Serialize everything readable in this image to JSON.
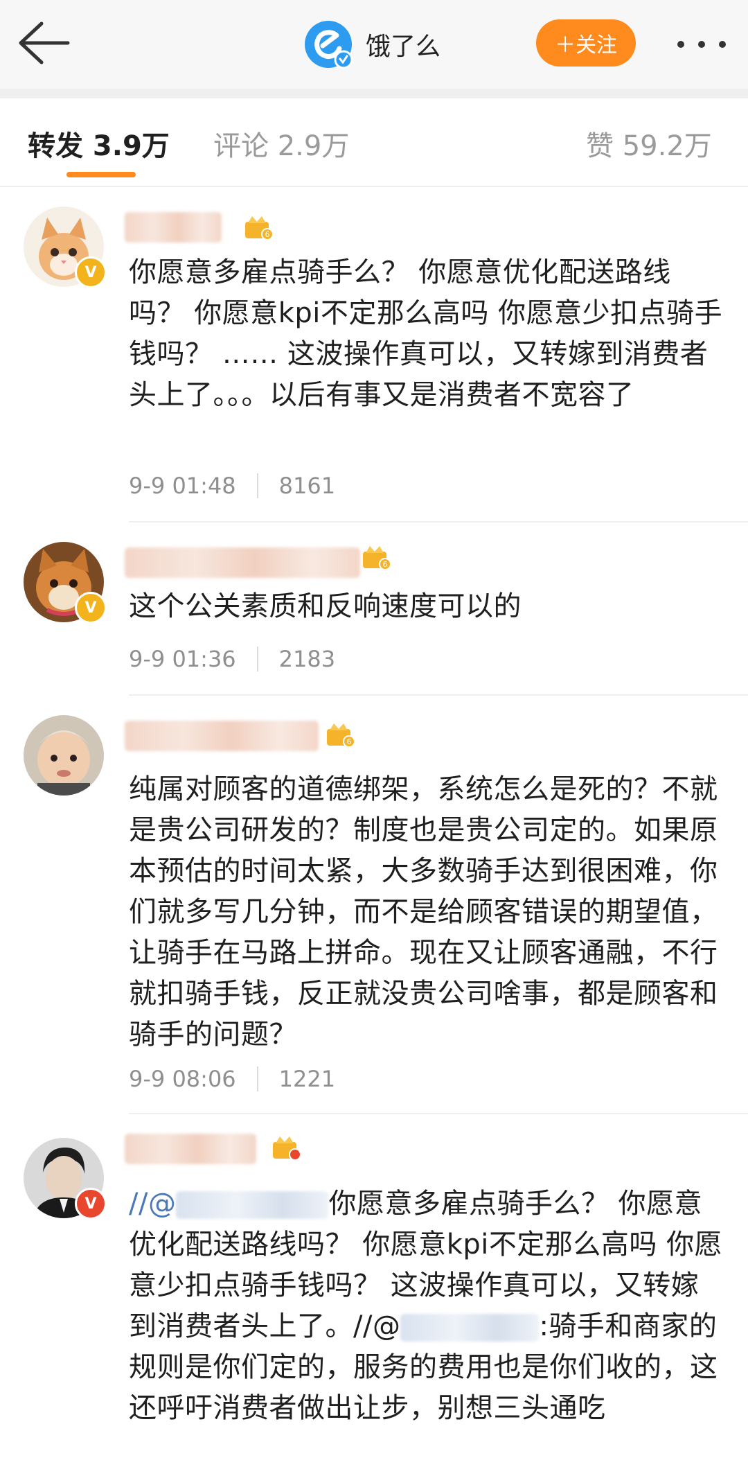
{
  "header": {
    "account_name": "饿了么",
    "follow_label": "＋关注",
    "brand_color": "#2d9cf0",
    "accent_color": "#ff8a1e"
  },
  "tabs": [
    {
      "label": "转发 3.9万",
      "active": true
    },
    {
      "label": "评论 2.9万",
      "active": false
    },
    {
      "label": "赞 59.2万",
      "active": false
    }
  ],
  "comments": [
    {
      "text": "你愿意多雇点骑手么？ 你愿意优化配送路线吗？ 你愿意kpi不定那么高吗 你愿意少扣点骑手钱吗？ …… 这波操作真可以，又转嫁到消费者头上了。。。以后有事又是消费者不宽容了",
      "time": "9-9 01:48",
      "likes": "8161",
      "badge_color": "#f2b31c"
    },
    {
      "text": "这个公关素质和反响速度可以的",
      "time": "9-9 01:36",
      "likes": "2183",
      "badge_color": "#f2b31c"
    },
    {
      "text": "纯属对顾客的道德绑架，系统怎么是死的？不就是贵公司研发的？制度也是贵公司定的。如果原本预估的时间太紧，大多数骑手达到很困难，你们就多写几分钟，而不是给顾客错误的期望值，让骑手在马路上拼命。现在又让顾客通融，不行就扣骑手钱，反正就没贵公司啥事，都是顾客和骑手的问题？",
      "time": "9-9 08:06",
      "likes": "1221",
      "badge_color": "#f2b31c"
    },
    {
      "mention_prefix": "//@",
      "text_part1": "你愿意多雇点骑手么？ 你愿意优化配送路线吗？ 你愿意kpi不定那么高吗 你愿意少扣点骑手钱吗？ 这波操作真可以，又转嫁到消费者头上了。//@",
      "text_part2": ":骑手和商家的规则是你们定的，服务的费用也是你们收的，这还呼吁消费者做出让步，别想三头通吃",
      "badge_color": "#e8462d"
    }
  ]
}
